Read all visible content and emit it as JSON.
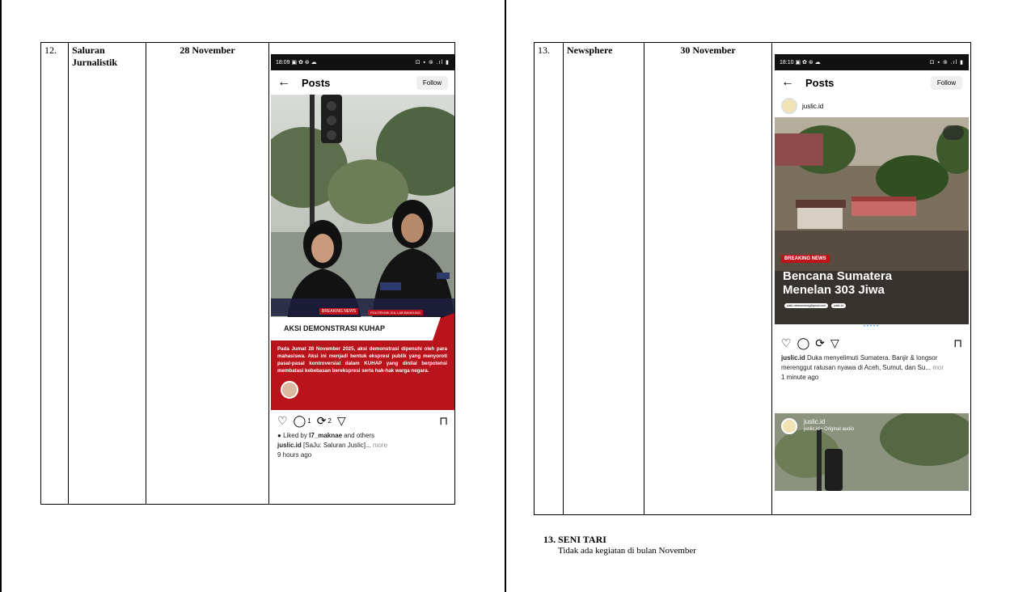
{
  "left_page": {
    "row": {
      "number": "12.",
      "name_line1": "Saluran",
      "name_line2": "Jurnalistik",
      "date": "28 November"
    },
    "phone": {
      "status_time": "18:09",
      "status_icons_left": "▣ ✿ ⊛ ☁",
      "status_icons_right": "⊡ ▪ ⊚ .ıl ▮",
      "title": "Posts",
      "follow": "Follow",
      "post": {
        "label_breaking": "BREAKING NEWS",
        "label_tag": "POLITEKNIK ZUL LAB BANDUNG",
        "headline": "AKSI DEMONSTRASI KUHAP",
        "body": "Pada Jumat 28 November 2025, aksi demonstrasi dipenuhi oleh para mahasiswa. Aksi ini menjadi bentuk ekspresi publik yang menyoroti pasal-pasal kontroversial dalam KUHAP yang dinilai berpotensi membatasi kebebasan berekspresi serta hak-hak warga negara."
      },
      "comments": "1",
      "reposts": "2",
      "liked_by_prefix": "Liked by ",
      "liked_by_user": "l7_maknae",
      "liked_by_suffix": " and others",
      "caption_user": "juslic.id",
      "caption_text": " [SaJu: Saluran Juslic]...",
      "caption_more": " more",
      "time": "9 hours ago"
    }
  },
  "right_page": {
    "row": {
      "number": "13.",
      "name": "Newsphere",
      "date": "30 November"
    },
    "phone": {
      "status_time": "18:10",
      "status_icons_left": "▣ ✿ ⊛ ☁",
      "status_icons_right": "⊡ ▪ ⊚ .ıl ▮",
      "title": "Posts",
      "follow": "Follow",
      "account": "juslic.id",
      "post": {
        "label_breaking": "BREAKING NEWS",
        "headline_line1": "Bencana Sumatera",
        "headline_line2": "Menelan 303 Jiwa",
        "chip1": "juslic.newsandung@gmail.com",
        "chip2": "juslic.id"
      },
      "caption_user": "juslic.id",
      "caption_text": " Duka menyelimuti Sumatera. Banjir & longsor merenggut ratusan nyawa di Aceh, Sumut, dan Su...",
      "caption_more": " mor",
      "time": "1 minute ago",
      "next_post_user": "juslic.id",
      "next_post_audio": "juslic.id • Original audio"
    },
    "section": {
      "heading": "13. SENI TARI",
      "body": "Tidak ada kegiatan di bulan November"
    }
  }
}
